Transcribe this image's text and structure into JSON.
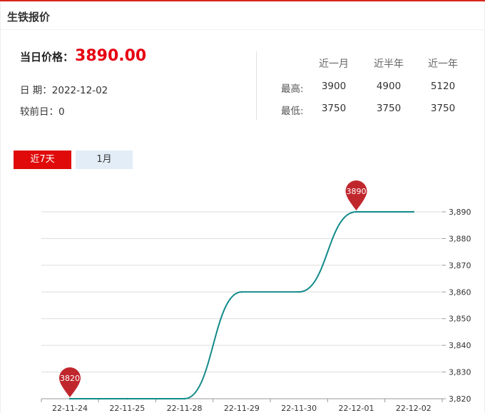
{
  "panel": {
    "title": "生铁报价"
  },
  "summary": {
    "price_label": "当日价格：",
    "price_value": "3890.00",
    "date_text": "日 期：2022-12-02",
    "change_text": "较前日：0"
  },
  "stats": {
    "headers": [
      "近一月",
      "近半年",
      "近一年"
    ],
    "rows": [
      {
        "label": "最高:",
        "values": [
          "3900",
          "4900",
          "5120"
        ]
      },
      {
        "label": "最低:",
        "values": [
          "3750",
          "3750",
          "3750"
        ]
      }
    ]
  },
  "tabs": [
    {
      "label": "近7天",
      "active": true
    },
    {
      "label": "1月",
      "active": false
    }
  ],
  "colors": {
    "accent": "#e00a0a",
    "line": "#138a8a",
    "marker": "#c0272d",
    "tab_inactive": "#e3edf7"
  },
  "chart_data": {
    "type": "line",
    "categories": [
      "22-11-24",
      "22-11-25",
      "22-11-28",
      "22-11-29",
      "22-11-30",
      "22-12-01",
      "22-12-02"
    ],
    "values": [
      3820,
      3820,
      3820,
      3860,
      3860,
      3890,
      3890
    ],
    "ylim": [
      3820,
      3890
    ],
    "yticks": [
      3820,
      3830,
      3840,
      3850,
      3860,
      3870,
      3880,
      3890
    ],
    "ytick_labels": [
      "3,820",
      "3,830",
      "3,840",
      "3,850",
      "3,860",
      "3,870",
      "3,880",
      "3,890"
    ],
    "grid": true,
    "smooth": true,
    "markers": [
      {
        "category": "22-11-24",
        "value": 3820,
        "label": "3820"
      },
      {
        "category": "22-12-01",
        "value": 3890,
        "label": "3890"
      }
    ]
  }
}
